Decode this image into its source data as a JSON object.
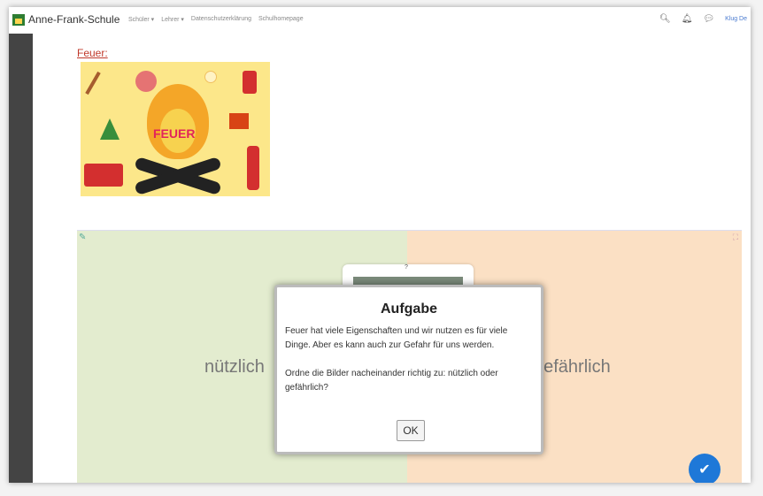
{
  "navbar": {
    "brand": "Anne-Frank-Schule",
    "links": [
      "Schüler",
      "Lehrer",
      "Datenschutzerklärung",
      "Schulhomepage"
    ],
    "user": "Klug De"
  },
  "content": {
    "section_title": "Feuer:",
    "image_word": "FEUER"
  },
  "game": {
    "left_label": "nützlich",
    "right_label": "gefährlich",
    "card_question": "?"
  },
  "dialog": {
    "title": "Aufgabe",
    "paragraph1": "Feuer hat viele Eigenschaften und wir nutzen es für viele Dinge. Aber es kann auch zur Gefahr für uns werden.",
    "paragraph2": "Ordne die Bilder nacheinander richtig zu: nützlich oder gefährlich?",
    "ok_label": "OK"
  }
}
